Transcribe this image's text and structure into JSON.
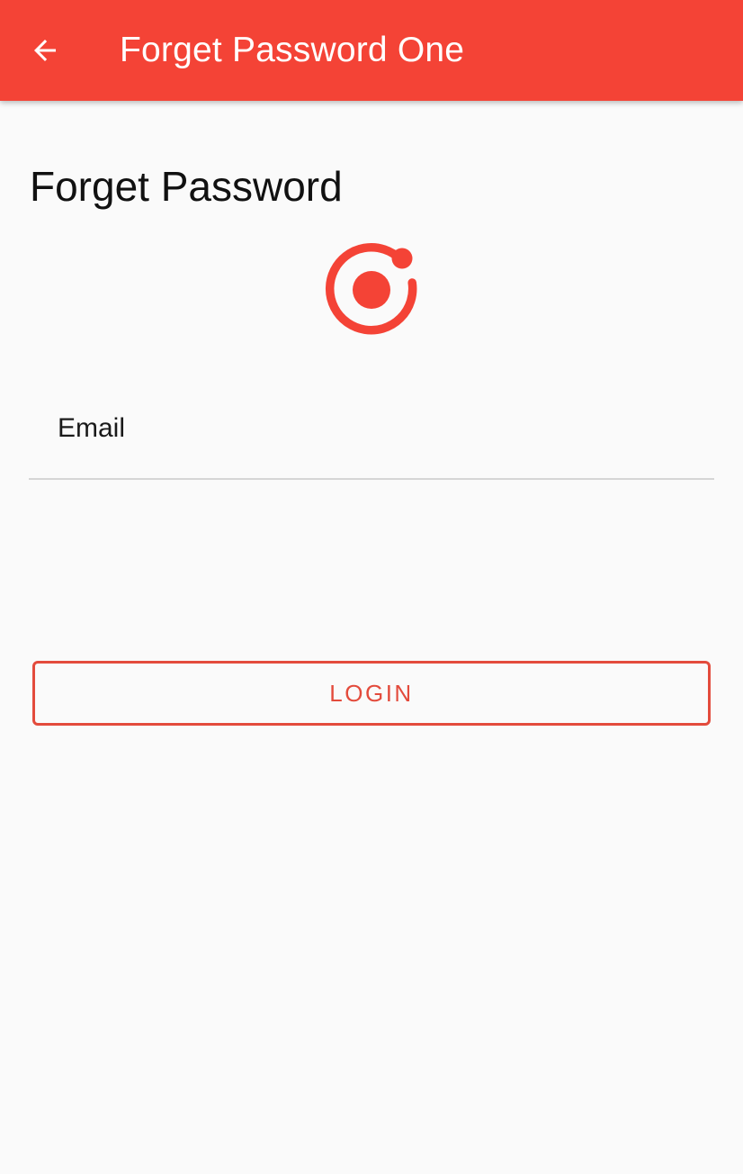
{
  "app_bar": {
    "title": "Forget Password One",
    "back_icon": "arrow-back-icon",
    "background_color": "#f44336"
  },
  "main": {
    "heading": "Forget Password",
    "logo_icon": "ionic-logo-icon",
    "accent_color": "#f44336"
  },
  "form": {
    "email_label": "Email",
    "email_value": "",
    "login_label": "LOGIN",
    "login_color": "#e34b3c"
  }
}
